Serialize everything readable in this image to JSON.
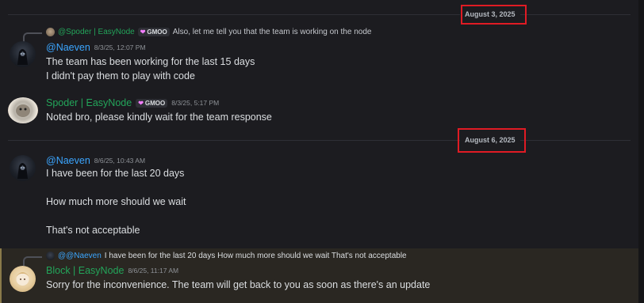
{
  "dates": {
    "first": "August 3, 2025",
    "second": "August 6, 2025"
  },
  "colors": {
    "naeven": "#3ba6ff",
    "easynode_green": "#23a55a",
    "highlight_box": "#e01b24"
  },
  "reply1": {
    "author": "@Spoder | EasyNode",
    "tag": "GMOO",
    "tag_icon": "heart-icon",
    "text": "Also, let me tell you that the team is working on the node"
  },
  "msg1": {
    "author": "@Naeven",
    "time": "8/3/25, 12:07 PM",
    "lines": [
      "The team has been working for the last 15 days",
      "I didn't pay them to play with code"
    ]
  },
  "msg2": {
    "author": "Spoder | EasyNode",
    "tag": "GMOO",
    "time": "8/3/25, 5:17 PM",
    "lines": [
      "Noted bro, please kindly wait for the team response"
    ]
  },
  "msg3": {
    "author": "@Naeven",
    "time": "8/6/25, 10:43 AM",
    "lines": [
      "I have been for the last 20 days",
      "How much more should we wait",
      "That's not acceptable"
    ]
  },
  "reply2": {
    "author": "@@Naeven",
    "text": "I have been for the last 20 days   How much more should we wait   That's not acceptable"
  },
  "msg4": {
    "author": "Block | EasyNode",
    "time": "8/6/25, 11:17 AM",
    "lines": [
      "Sorry for the inconvenience. The team will get back to you as soon as there's an update"
    ]
  }
}
